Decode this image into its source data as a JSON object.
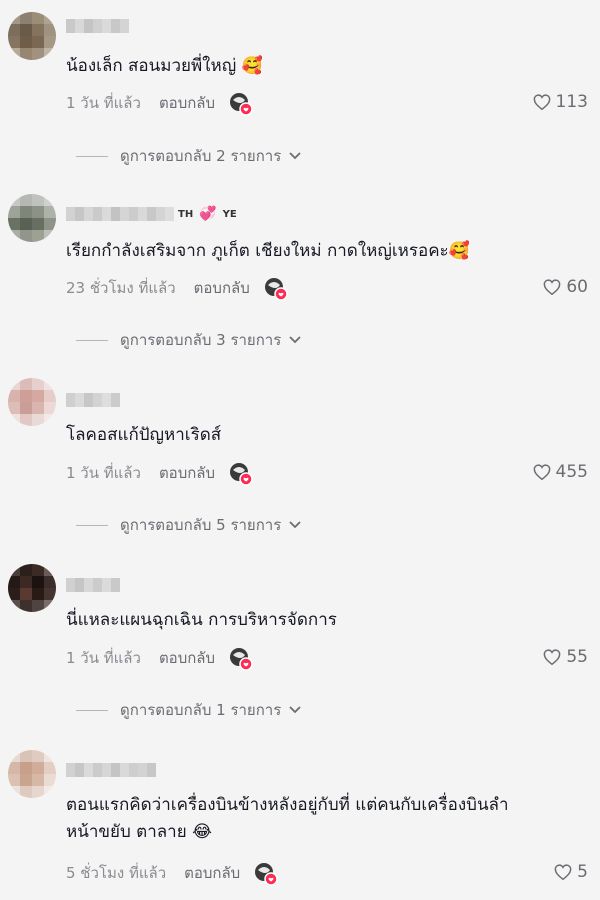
{
  "comments": [
    {
      "text": "น้องเล็ก สอนมวยพี่ใหญ่ 🥰",
      "time": "1 วัน ที่แล้ว",
      "reply": "ตอบกลับ",
      "likes": "113",
      "view_replies": "ดูการตอบกลับ 2 รายการ"
    },
    {
      "name_extra_1": "TH",
      "name_extra_2": "YE",
      "text": "เรียกกำลังเสริมจาก ภูเก็ต เชียงใหม่ กาดใหญ่เหรอคะ🥰",
      "time": "23 ชั่วโมง ที่แล้ว",
      "reply": "ตอบกลับ",
      "likes": "60",
      "view_replies": "ดูการตอบกลับ 3 รายการ"
    },
    {
      "text": "โลคอสแก้ปัญหาเริดส์",
      "time": "1 วัน ที่แล้ว",
      "reply": "ตอบกลับ",
      "likes": "455",
      "view_replies": "ดูการตอบกลับ 5 รายการ"
    },
    {
      "text": "นี่แหละแผนฉุกเฉิน การบริหารจัดการ",
      "time": "1 วัน ที่แล้ว",
      "reply": "ตอบกลับ",
      "likes": "55",
      "view_replies": "ดูการตอบกลับ 1 รายการ"
    },
    {
      "text_line1": "ตอนแรกคิดว่าเครื่องบินข้างหลังอยู่กับที่ แต่คนกับเครื่องบินลำ",
      "text_line2": "หน้าขยับ ตาลาย 😂",
      "time": "5 ชั่วโมง ที่แล้ว",
      "reply": "ตอบกลับ",
      "likes": "5"
    }
  ],
  "icons": {
    "heart": "heart-outline-icon",
    "chevron": "chevron-down-icon"
  },
  "colors": {
    "background": "#f4f4f4",
    "text": "#161823",
    "muted": "#8a8b91",
    "accent": "#fe2c55"
  }
}
